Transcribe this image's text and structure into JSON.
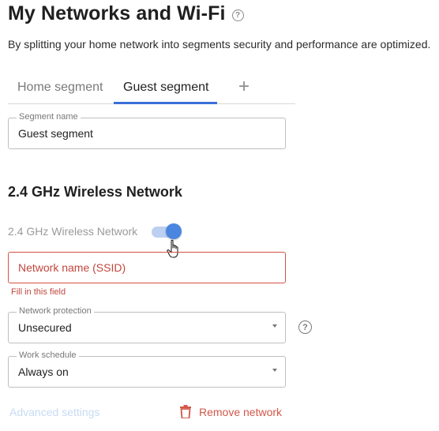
{
  "page": {
    "title": "My Networks and Wi-Fi",
    "help_glyph": "?",
    "subtitle": "By splitting your home network into segments security and performance are optimized."
  },
  "tabs": [
    {
      "label": "Home segment",
      "active": false
    },
    {
      "label": "Guest segment",
      "active": true
    }
  ],
  "tab_add_glyph": "+",
  "segment_name": {
    "legend": "Segment name",
    "value": "Guest segment"
  },
  "wifi": {
    "section_title": "2.4 GHz Wireless Network",
    "toggle_label": "2.4 GHz Wireless Network",
    "toggle_on": true,
    "ssid_placeholder": "Network name (SSID)",
    "ssid_error": "Fill in this field",
    "protection": {
      "legend": "Network protection",
      "value": "Unsecured"
    },
    "schedule": {
      "legend": "Work schedule",
      "value": "Always on"
    },
    "help_glyph": "?"
  },
  "footer": {
    "advanced_label": "Advanced settings",
    "remove_label": "Remove network"
  },
  "colors": {
    "accent": "#3a6fd8",
    "toggle_thumb": "#4a86e0",
    "error": "#c0473d",
    "remove": "#d2574a",
    "disabled_link": "#c7dbf4"
  },
  "icons": {
    "title_help": "help-circle-icon",
    "protection_help": "help-circle-icon",
    "tab_add": "plus-icon",
    "remove": "trash-icon",
    "cursor": "hand-pointer-icon",
    "select_arrow": "chevron-down-icon"
  }
}
